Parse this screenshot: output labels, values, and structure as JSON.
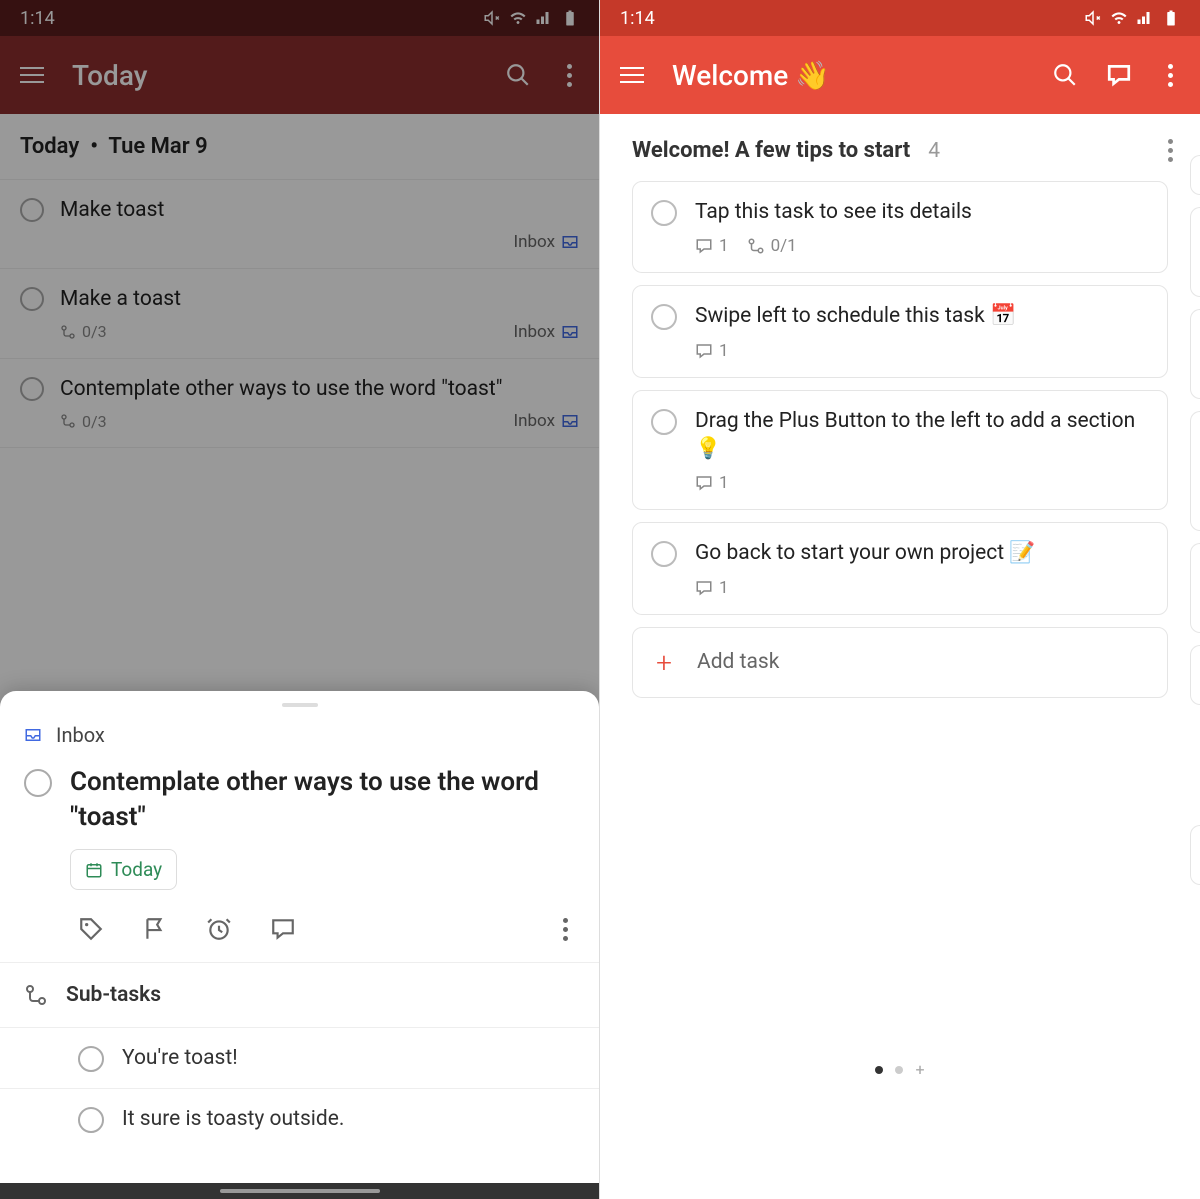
{
  "status": {
    "time": "1:14"
  },
  "left": {
    "appbar_title": "Today",
    "header_today": "Today",
    "header_date": "Tue Mar 9",
    "tasks": [
      {
        "title": "Make toast",
        "project": "Inbox",
        "subtasks": null
      },
      {
        "title": "Make a toast",
        "project": "Inbox",
        "subtasks": "0/3"
      },
      {
        "title": "Contemplate other ways to use the word \"toast\"",
        "project": "Inbox",
        "subtasks": "0/3"
      }
    ],
    "sheet": {
      "project": "Inbox",
      "task_title": "Contemplate other ways to use the word \"toast\"",
      "due_label": "Today",
      "subtasks_header": "Sub-tasks",
      "subtasks": [
        "You're toast!",
        "It sure is toasty outside."
      ]
    }
  },
  "right": {
    "appbar_title": "Welcome 👋",
    "section_title": "Welcome! A few tips to start",
    "section_count": "4",
    "tasks": [
      {
        "title": "Tap this task to see its details",
        "comments": "1",
        "subtasks": "0/1"
      },
      {
        "title": "Swipe left to schedule this task 📅",
        "comments": "1",
        "subtasks": null
      },
      {
        "title": "Drag the Plus Button to the left to add a section 💡",
        "comments": "1",
        "subtasks": null
      },
      {
        "title": "Go back to start your own project 📝",
        "comments": "1",
        "subtasks": null
      }
    ],
    "add_task_label": "Add task"
  }
}
